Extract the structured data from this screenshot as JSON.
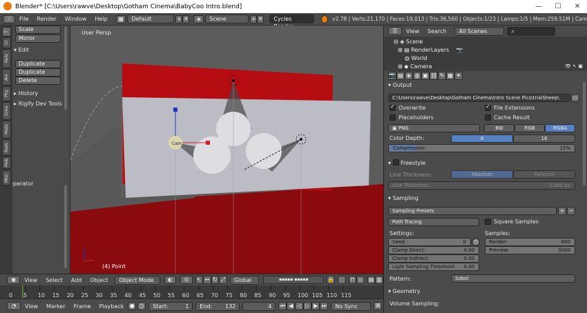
{
  "window": {
    "title": "Blender* [C:\\Users\\rawve\\Desktop\\Gotham Cinema\\BabyCoo Intro.blend]",
    "minimize": "—",
    "maximize": "☐",
    "close": "✕"
  },
  "topbar": {
    "menus": [
      "File",
      "Render",
      "Window",
      "Help"
    ],
    "layout": "Default",
    "scene": "Scene",
    "engine": "Cycles Render",
    "stats": "v2.78 | Verts:21,170 | Faces:19,013 | Tris:36,560 | Objects:1/23 | Lamps:1/5 | Mem:259.51M | Cam"
  },
  "toolshelf": {
    "tabs": [
      "Tools",
      "Create",
      "Relations",
      "Animation",
      "Physics",
      "Grease Pencil",
      "Materials",
      "Names",
      "Make",
      "Misc",
      "Make"
    ],
    "tab_short": [
      "T",
      "Cr",
      "Rela",
      "Ani",
      "Phy",
      "Grea",
      "Mate",
      "Nam",
      "Mak",
      "Misc",
      "Mak"
    ],
    "transform_buttons": [
      "Scale",
      "Mirror"
    ],
    "edit_header": "Edit",
    "edit_buttons": [
      "Duplicate",
      "Duplicate Linked",
      "Delete"
    ],
    "history_header": "History",
    "rigify_header": "Rigify Dev Tools",
    "operator_header": "Operator"
  },
  "viewport": {
    "view_label": "User Persp",
    "object_label": "(4) Point",
    "lamp_label": "Cam"
  },
  "v3d_header": {
    "menus": [
      "View",
      "Select",
      "Add",
      "Object"
    ],
    "mode": "Object Mode",
    "orientation": "Global"
  },
  "timeline": {
    "ticks": [
      "0",
      "5",
      "10",
      "15",
      "20",
      "25",
      "30",
      "35",
      "40",
      "45",
      "50",
      "55",
      "60",
      "65",
      "70",
      "75",
      "80",
      "85",
      "90",
      "95",
      "100",
      "105",
      "110",
      "115"
    ]
  },
  "tl_header": {
    "menus": [
      "View",
      "Marker",
      "Frame",
      "Playback"
    ],
    "start_label": "Start:",
    "start_value": "1",
    "end_label": "End:",
    "end_value": "132",
    "current": "4",
    "sync": "No Sync"
  },
  "outliner": {
    "menus": [
      "View",
      "Search"
    ],
    "filter": "All Scenes",
    "items": [
      "Scene",
      "RenderLayers",
      "World",
      "Camera"
    ]
  },
  "properties": {
    "output": {
      "header": "Output",
      "path": "C:\\Users\\rawve\\Desktop\\Gotham Cinema\\Intro Scene Pics\\trialSheep\\",
      "overwrite": "Overwrite",
      "file_extensions": "File Extensions",
      "placeholders": "Placeholders",
      "cache_result": "Cache Result",
      "format": "PNG",
      "color_modes": [
        "BW",
        "RGB",
        "RGBA"
      ],
      "color_depth_label": "Color Depth:",
      "depth_options": [
        "8",
        "16"
      ],
      "compression_label": "Compression:",
      "compression_value": "15%",
      "compression": 0.15
    },
    "freestyle": {
      "header": "Freestyle",
      "line_thickness_label": "Line Thickness:",
      "modes": [
        "Absolute",
        "Relative"
      ],
      "line_thickness_field": "Line Thickness:",
      "line_thickness_value": "1.000 px"
    },
    "sampling": {
      "header": "Sampling",
      "presets": "Sampling Presets",
      "method": "Path Tracing",
      "square_samples": "Square Samples",
      "settings_label": "Settings:",
      "samples_label": "Samples:",
      "seed_label": "Seed:",
      "seed_value": "0",
      "clamp_direct_label": "Clamp Direct:",
      "clamp_direct_value": "4.00",
      "clamp_indirect_label": "Clamp Indirect:",
      "clamp_indirect_value": "0.00",
      "light_threshold_label": "Light Sampling Threshold:",
      "light_threshold_value": "0.00",
      "render_label": "Render:",
      "render_value": "800",
      "preview_label": "Preview:",
      "preview_value": "3000",
      "pattern_label": "Pattern:",
      "pattern_value": "Sobol"
    },
    "geometry": {
      "header": "Geometry",
      "volume_sampling": "Volume Sampling:"
    }
  },
  "colors": {
    "accent": "#5680c2",
    "red": "#b50d12",
    "panel": "#4b4b4b"
  }
}
